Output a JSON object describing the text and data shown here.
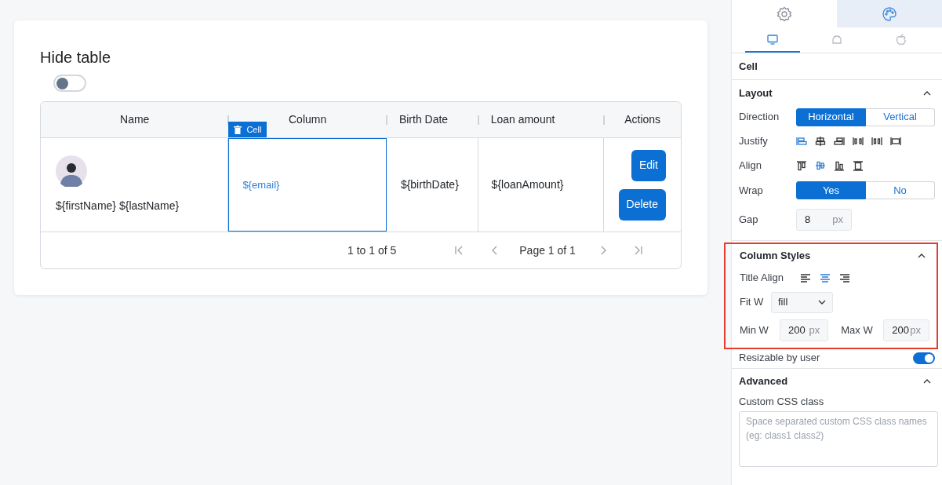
{
  "card": {
    "title": "Hide table",
    "toggle": {
      "on": false
    }
  },
  "table": {
    "columns": [
      "Name",
      "Column",
      "Birth Date",
      "Loan amount",
      "Actions"
    ],
    "rows": [
      {
        "name": "${firstName} ${lastName}",
        "column": "${email}",
        "birth_date": "${birthDate}",
        "loan_amount": "${loanAmount}",
        "actions": [
          "Edit",
          "Delete"
        ]
      }
    ],
    "selected_cell_badge": "Cell",
    "footer": {
      "range": "1 to 1 of 5",
      "page": "Page 1 of 1"
    }
  },
  "panel": {
    "top_tabs": [
      {
        "kind": "settings",
        "selected": false
      },
      {
        "kind": "palette",
        "selected": true
      }
    ],
    "device_tabs": [
      {
        "kind": "desktop",
        "selected": true
      },
      {
        "kind": "android",
        "selected": false
      },
      {
        "kind": "apple",
        "selected": false
      }
    ],
    "element_title": "Cell",
    "layout": {
      "title": "Layout",
      "expanded": true,
      "direction": {
        "label": "Direction",
        "options": [
          {
            "label": "Horizontal",
            "selected": true
          },
          {
            "label": "Vertical",
            "selected": false
          }
        ]
      },
      "justify": {
        "label": "Justify",
        "options": [
          {
            "kind": "start",
            "selected": true
          },
          {
            "kind": "center",
            "selected": false
          },
          {
            "kind": "end",
            "selected": false
          },
          {
            "kind": "between",
            "selected": false
          },
          {
            "kind": "around",
            "selected": false
          },
          {
            "kind": "stretch",
            "selected": false
          }
        ]
      },
      "align": {
        "label": "Align",
        "options": [
          {
            "kind": "top",
            "selected": false
          },
          {
            "kind": "center",
            "selected": true
          },
          {
            "kind": "bottom",
            "selected": false
          },
          {
            "kind": "stretch",
            "selected": false
          }
        ]
      },
      "wrap": {
        "label": "Wrap",
        "options": [
          {
            "label": "Yes",
            "selected": true
          },
          {
            "label": "No",
            "selected": false
          }
        ]
      },
      "gap": {
        "label": "Gap",
        "value": "8",
        "unit": "px"
      }
    },
    "column_styles": {
      "title": "Column Styles",
      "expanded": true,
      "highlighted": true,
      "title_align": {
        "label": "Title Align",
        "options": [
          {
            "kind": "left",
            "selected": false
          },
          {
            "kind": "center",
            "selected": true
          },
          {
            "kind": "right",
            "selected": false
          }
        ]
      },
      "fit_w": {
        "label": "Fit W",
        "value": "fill"
      },
      "min_w": {
        "label": "Min W",
        "value": "200",
        "unit": "px"
      },
      "max_w": {
        "label": "Max W",
        "value": "200",
        "unit": "px"
      }
    },
    "resizable": {
      "label": "Resizable by user",
      "on": true
    },
    "advanced": {
      "title": "Advanced",
      "expanded": true,
      "custom_css": {
        "label": "Custom CSS class",
        "placeholder": "Space separated custom CSS class names (eg: class1 class2)"
      }
    }
  }
}
